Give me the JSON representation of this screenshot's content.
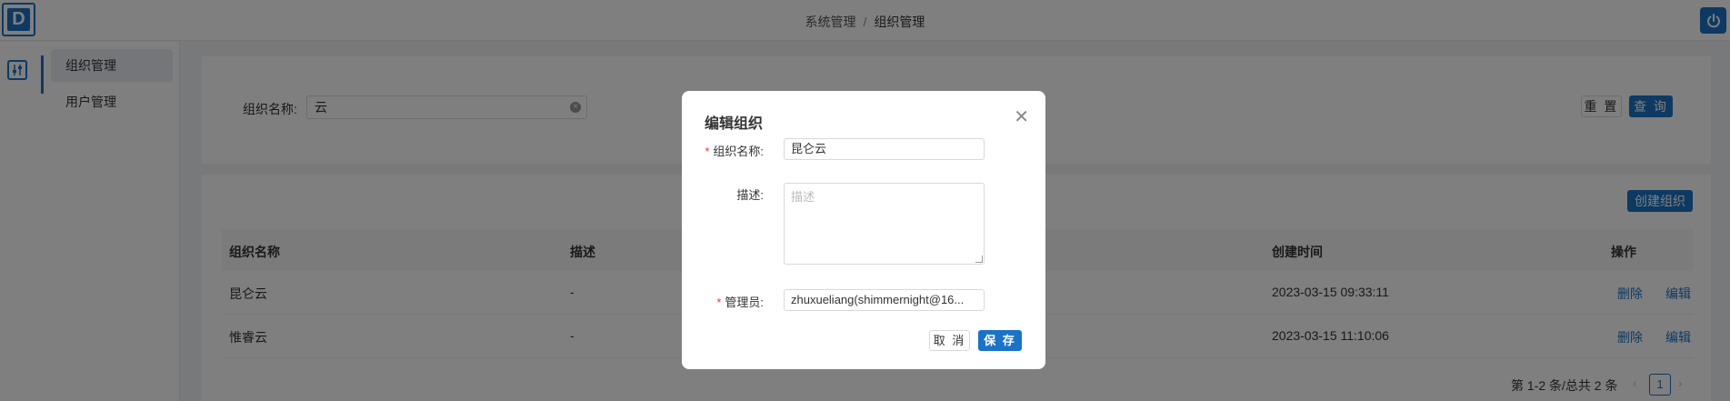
{
  "header": {
    "logo_letter": "D",
    "breadcrumb": {
      "parent": "系统管理",
      "separator": "/",
      "current": "组织管理"
    },
    "power_icon": "power-icon"
  },
  "sidebar": {
    "items": [
      {
        "label": "组织管理",
        "active": true
      },
      {
        "label": "用户管理",
        "active": false
      }
    ]
  },
  "search": {
    "label": "组织名称:",
    "value": "云",
    "reset_label": "重 置",
    "query_label": "查 询"
  },
  "table": {
    "create_label": "创建组织",
    "columns": [
      "组织名称",
      "描述",
      "创建时间",
      "操作"
    ],
    "rows": [
      {
        "name": "昆仑云",
        "desc": "-",
        "created": "2023-03-15 09:33:11",
        "delete": "删除",
        "edit": "编辑"
      },
      {
        "name": "惟睿云",
        "desc": "-",
        "created": "2023-03-15 11:10:06",
        "delete": "删除",
        "edit": "编辑"
      }
    ],
    "pagination": {
      "summary": "第 1-2 条/总共 2 条",
      "current_page": "1",
      "prev": "‹",
      "next": "›"
    }
  },
  "modal": {
    "title": "编辑组织",
    "close": "✕",
    "name_label": "组织名称:",
    "name_value": "昆仑云",
    "desc_label": "描述:",
    "desc_placeholder": "描述",
    "admin_label": "管理员:",
    "admin_value": "zhuxueliang(shimmernight@16...",
    "required_mark": "*",
    "cancel_label": "取 消",
    "save_label": "保 存"
  },
  "colors": {
    "primary": "#1a73c7",
    "required": "#e53935"
  }
}
